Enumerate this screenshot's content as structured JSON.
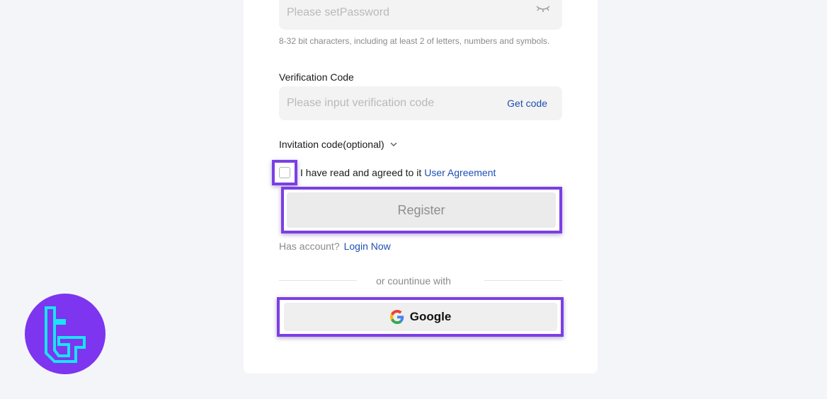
{
  "password": {
    "placeholder": "Please setPassword",
    "hint": "8-32 bit characters, including at least 2 of letters, numbers and symbols.",
    "toggle_icon": "eye-closed-icon"
  },
  "verification": {
    "label": "Verification Code",
    "placeholder": "Please input verification code",
    "get_code": "Get code"
  },
  "invitation": {
    "label": "Invitation code(optional)",
    "icon": "chevron-down-icon"
  },
  "agreement": {
    "text": "I have read and agreed to it",
    "link": "User Agreement",
    "checked": false
  },
  "register": {
    "label": "Register"
  },
  "login": {
    "prompt": "Has account?",
    "link": "Login Now"
  },
  "divider": {
    "text": "or countinue with"
  },
  "google": {
    "label": "Google",
    "icon": "google-icon"
  },
  "colors": {
    "accent_link": "#1d4fb3",
    "highlight": "#7b3fe4",
    "logo_bg": "#7d35f0",
    "logo_fg": "#19e3f5"
  }
}
